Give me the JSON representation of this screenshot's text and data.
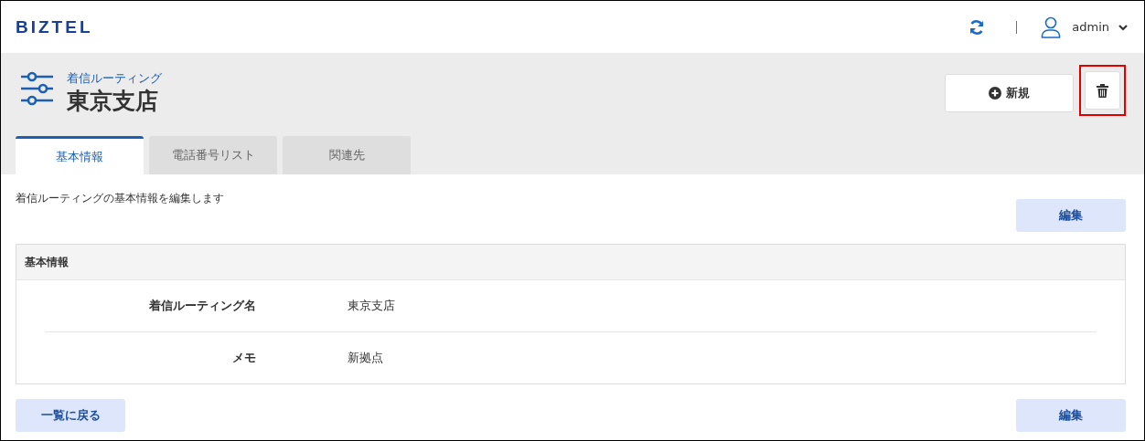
{
  "header": {
    "logo": "BIZTEL",
    "user": "admin"
  },
  "page": {
    "category": "着信ルーティング",
    "title": "東京支店"
  },
  "actions": {
    "new_button": {
      "label": "新規"
    },
    "delete_button": {
      "highlighted": true
    }
  },
  "tabs": [
    {
      "label": "基本情報",
      "selected": true
    },
    {
      "label": "電話番号リスト",
      "selected": false
    },
    {
      "label": "関連先",
      "selected": false
    }
  ],
  "description": "着信ルーティングの基本情報を編集します",
  "edit_button_top": "編集",
  "panel": {
    "title": "基本情報",
    "rows": [
      {
        "label": "着信ルーティング名",
        "value": "東京支店"
      },
      {
        "label": "メモ",
        "value": "新拠点"
      }
    ]
  },
  "back_button": "一覧に戻る",
  "edit_button_bottom": "編集"
}
